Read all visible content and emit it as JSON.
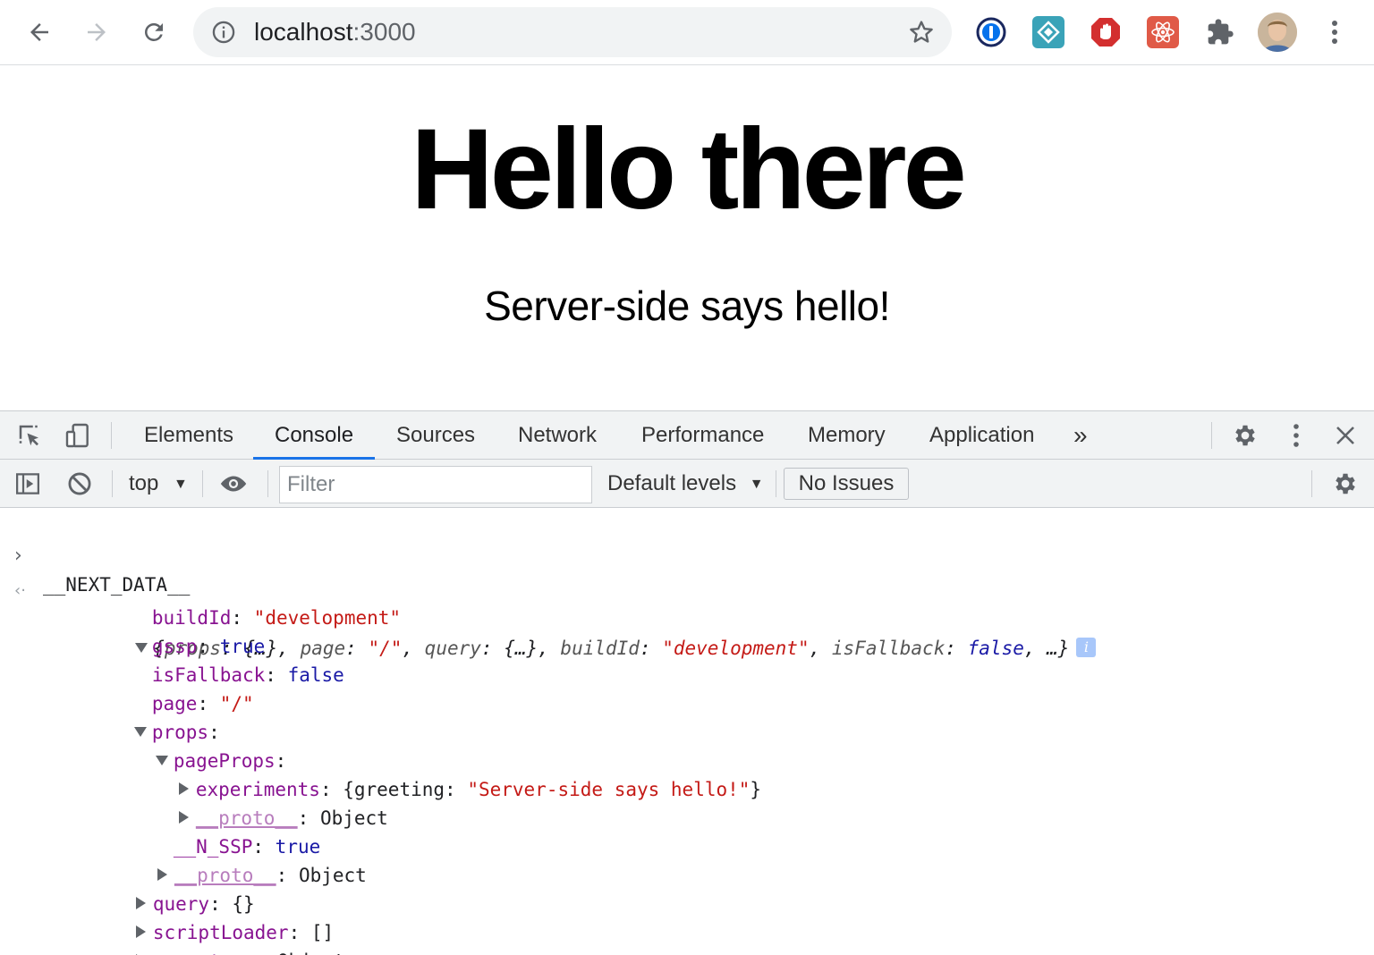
{
  "browser": {
    "url_host": "localhost",
    "url_port": ":3000",
    "extensions": [
      "1password-icon",
      "bitwarden-icon",
      "adblock-icon",
      "react-devtools-icon",
      "extensions-puzzle-icon",
      "profile-avatar"
    ]
  },
  "page": {
    "heading": "Hello there",
    "message": "Server-side says hello!"
  },
  "devtools": {
    "tabs": [
      "Elements",
      "Console",
      "Sources",
      "Network",
      "Performance",
      "Memory",
      "Application"
    ],
    "active_tab": "Console",
    "more_tabs": "»",
    "context": "top",
    "filter_placeholder": "Filter",
    "levels": "Default levels",
    "issues": "No Issues"
  },
  "console": {
    "input": "__NEXT_DATA__",
    "summary": {
      "open": "{",
      "k_props": "props",
      "v_props": "{…}",
      "k_page": "page",
      "v_page": "\"/\"",
      "k_query": "query",
      "v_query": "{…}",
      "k_buildId": "buildId",
      "v_buildId": "\"development\"",
      "k_isFallback": "isFallback",
      "v_isFallback": "false",
      "close": "…}",
      "info": "i"
    },
    "entries": {
      "buildId_key": "buildId",
      "buildId_val": "\"development\"",
      "gssp_key": "gssp",
      "gssp_val": "true",
      "isFallback_key": "isFallback",
      "isFallback_val": "false",
      "page_key": "page",
      "page_val": "\"/\"",
      "props_key": "props",
      "pageProps_key": "pageProps",
      "experiments_key": "experiments",
      "experiments_inner_key": "greeting",
      "experiments_inner_val": "\"Server-side says hello!\"",
      "proto_key": "__proto__",
      "proto_val": "Object",
      "nssp_key": "__N_SSP",
      "nssp_val": "true",
      "query_key": "query",
      "query_val": "{}",
      "scriptLoader_key": "scriptLoader",
      "scriptLoader_val": "[]"
    }
  },
  "colors": {
    "accent": "#1a73e8",
    "key": "#881391",
    "string": "#c41a16",
    "boolean": "#1a1aa6"
  }
}
